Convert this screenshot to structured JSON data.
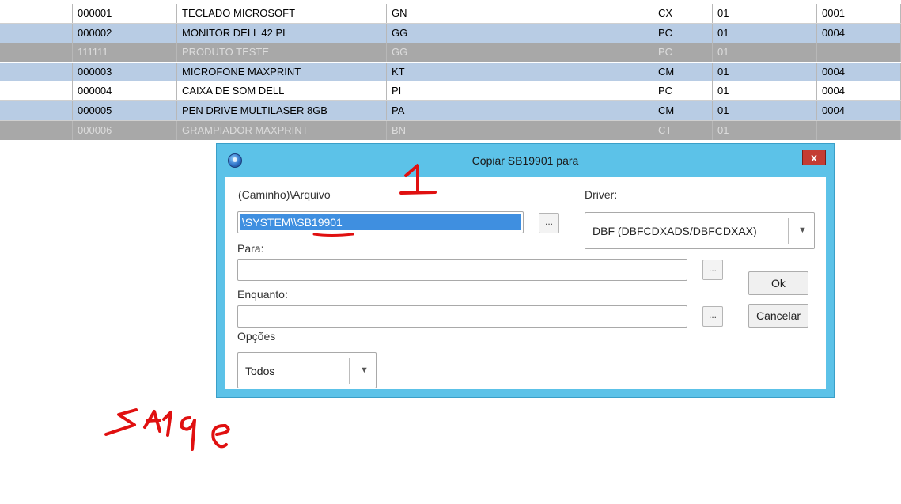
{
  "table": {
    "rows": [
      {
        "style": "white",
        "cells": [
          "",
          "000001",
          "TECLADO MICROSOFT",
          "GN",
          "",
          "CX",
          "01",
          "0001"
        ]
      },
      {
        "style": "blue",
        "cells": [
          "",
          "000002",
          "MONITOR DELL 42 PL",
          "GG",
          "",
          "PC",
          "01",
          "0004"
        ]
      },
      {
        "style": "grey",
        "cells": [
          "",
          "111111",
          "PRODUTO TESTE",
          "GG",
          "",
          "PC",
          "01",
          ""
        ]
      },
      {
        "style": "blue",
        "cells": [
          "",
          "000003",
          "MICROFONE MAXPRINT",
          "KT",
          "",
          "CM",
          "01",
          "0004"
        ]
      },
      {
        "style": "white",
        "cells": [
          "",
          "000004",
          "CAIXA DE SOM DELL",
          "PI",
          "",
          "PC",
          "01",
          "0004"
        ]
      },
      {
        "style": "blue",
        "cells": [
          "",
          "000005",
          "PEN DRIVE MULTILASER 8GB",
          "PA",
          "",
          "CM",
          "01",
          "0004"
        ]
      },
      {
        "style": "grey",
        "cells": [
          "",
          "000006",
          "GRAMPIADOR MAXPRINT",
          "BN",
          "",
          "CT",
          "01",
          ""
        ]
      }
    ]
  },
  "dialog": {
    "title": "Copiar SB19901 para",
    "close_label": "x",
    "file_label": "(Caminho)\\Arquivo",
    "file_value": "\\SYSTEM\\\\SB19901",
    "driver_label": "Driver:",
    "driver_value": "DBF (DBFCDXADS/DBFCDXAX)",
    "para_label": "Para:",
    "para_value": "",
    "enquanto_label": "Enquanto:",
    "enquanto_value": "",
    "opcoes_label": "Opções",
    "opcoes_value": "Todos",
    "browse_label": "...",
    "ok_label": "Ok",
    "cancel_label": "Cancelar"
  },
  "annotations": {
    "number_mark": "1",
    "handwritten_text": "SA19e",
    "ink_color": "#e01010"
  },
  "colors": {
    "dialog_frame": "#5cc2e8",
    "row_blue": "#b8cce4",
    "row_grey": "#a8a8a8",
    "selection": "#3f8fe0",
    "close_button": "#c43c32"
  }
}
